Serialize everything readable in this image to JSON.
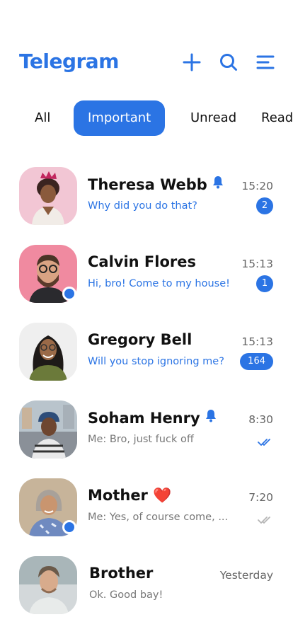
{
  "app": {
    "title": "Telegram"
  },
  "header": {
    "actions": [
      {
        "icon": "plus-icon"
      },
      {
        "icon": "search-icon"
      },
      {
        "icon": "menu-icon"
      }
    ]
  },
  "tabs": [
    {
      "label": "All",
      "active": false
    },
    {
      "label": "Important",
      "active": true
    },
    {
      "label": "Unread",
      "active": false
    },
    {
      "label": "Read",
      "active": false
    }
  ],
  "colors": {
    "accent": "#2b74e4",
    "read_tick": "#b5b5b5"
  },
  "chats": [
    {
      "name": "Theresa Webb",
      "muted": true,
      "emoji": "",
      "message": "Why did you do that?",
      "message_unread": true,
      "time": "15:20",
      "badge": "2",
      "ticks": "",
      "online": false
    },
    {
      "name": "Calvin Flores",
      "muted": false,
      "emoji": "",
      "message": "Hi, bro! Come to my house!",
      "message_unread": true,
      "time": "15:13",
      "badge": "1",
      "ticks": "",
      "online": true
    },
    {
      "name": "Gregory Bell",
      "muted": false,
      "emoji": "",
      "message": "Will you stop ignoring me?",
      "message_unread": true,
      "time": "15:13",
      "badge": "164",
      "ticks": "",
      "online": false
    },
    {
      "name": "Soham Henry",
      "muted": true,
      "emoji": "",
      "message": "Me: Bro, just fuck off",
      "message_unread": false,
      "time": "8:30",
      "badge": "",
      "ticks": "double-check-blue",
      "online": false
    },
    {
      "name": "Mother",
      "muted": false,
      "emoji": "❤️",
      "message": "Me: Yes, of course come, ...",
      "message_unread": false,
      "time": "7:20",
      "badge": "",
      "ticks": "double-check-gray",
      "online": true
    },
    {
      "name": "Brother",
      "muted": false,
      "emoji": "",
      "message": "Ok. Good bay!",
      "message_unread": false,
      "time": "Yesterday",
      "badge": "",
      "ticks": "",
      "online": false
    }
  ]
}
